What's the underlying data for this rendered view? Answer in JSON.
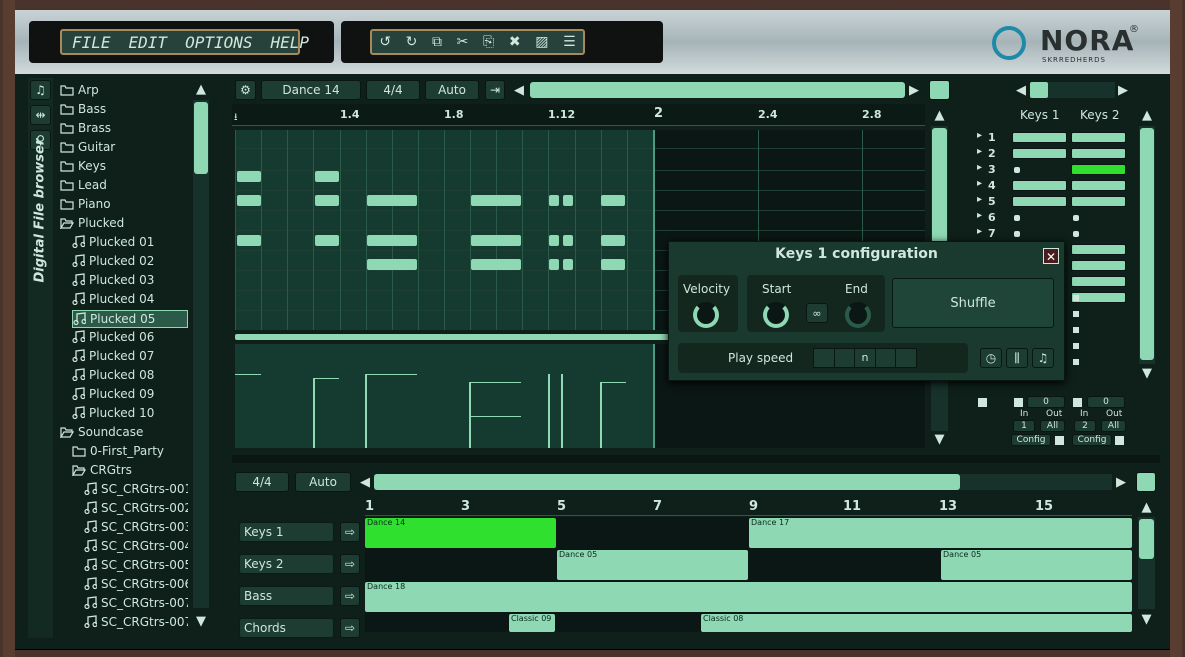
{
  "menu": {
    "file": "FILE",
    "edit": "EDIT",
    "options": "OPTIONS",
    "help": "HELP"
  },
  "logo": {
    "name": "NORA",
    "registered": "®",
    "vendor": "SKRREDHERDS"
  },
  "sidebar": {
    "title": "Digital File browser"
  },
  "browser": {
    "items": [
      {
        "label": "Arp",
        "type": "folder"
      },
      {
        "label": "Bass",
        "type": "folder"
      },
      {
        "label": "Brass",
        "type": "folder"
      },
      {
        "label": "Guitar",
        "type": "folder"
      },
      {
        "label": "Keys",
        "type": "folder"
      },
      {
        "label": "Lead",
        "type": "folder"
      },
      {
        "label": "Piano",
        "type": "folder"
      },
      {
        "label": "Plucked",
        "type": "folder-open"
      },
      {
        "label": "Plucked 01",
        "type": "file"
      },
      {
        "label": "Plucked 02",
        "type": "file"
      },
      {
        "label": "Plucked 03",
        "type": "file"
      },
      {
        "label": "Plucked 04",
        "type": "file"
      },
      {
        "label": "Plucked 05",
        "type": "file",
        "selected": true
      },
      {
        "label": "Plucked 06",
        "type": "file"
      },
      {
        "label": "Plucked 07",
        "type": "file"
      },
      {
        "label": "Plucked 08",
        "type": "file"
      },
      {
        "label": "Plucked 09",
        "type": "file"
      },
      {
        "label": "Plucked 10",
        "type": "file"
      },
      {
        "label": "Soundcase",
        "type": "folder-open"
      },
      {
        "label": "0-First_Party",
        "type": "folder"
      },
      {
        "label": "CRGtrs",
        "type": "folder-open"
      },
      {
        "label": "SC_CRGtrs-001",
        "type": "file"
      },
      {
        "label": "SC_CRGtrs-002",
        "type": "file"
      },
      {
        "label": "SC_CRGtrs-003",
        "type": "file"
      },
      {
        "label": "SC_CRGtrs-004",
        "type": "file"
      },
      {
        "label": "SC_CRGtrs-005",
        "type": "file"
      },
      {
        "label": "SC_CRGtrs-006",
        "type": "file"
      },
      {
        "label": "SC_CRGtrs-007",
        "type": "file"
      },
      {
        "label": "SC_CRGtrs-007",
        "type": "file"
      }
    ]
  },
  "pattern": {
    "name": "Dance 14",
    "signature": "4/4",
    "mode": "Auto"
  },
  "ruler": {
    "marks": [
      "1.4",
      "1.8",
      "1.12",
      "2",
      "2.4",
      "2.8"
    ]
  },
  "keys": {
    "rows": [
      "1",
      "2",
      "3",
      "4",
      "5",
      "6",
      "7"
    ],
    "col1": "Keys 1",
    "col2": "Keys 2",
    "k1_in_value": "0",
    "k1_in": "In",
    "k1_out": "Out",
    "k1_in_ch": "1",
    "k1_out_ch": "All",
    "k1_config": "Config",
    "k2_in_value": "0",
    "k2_in": "In",
    "k2_out": "Out",
    "k2_in_ch": "2",
    "k2_out_ch": "All",
    "k2_config": "Config"
  },
  "dialog": {
    "title": "Keys 1 configuration",
    "velocity": "Velocity",
    "start": "Start",
    "end": "End",
    "shuffle": "Shuffle",
    "play_speed": "Play speed",
    "speed_value": "n"
  },
  "song": {
    "signature": "4/4",
    "mode": "Auto",
    "bars": [
      "1",
      "3",
      "5",
      "7",
      "9",
      "11",
      "13",
      "15"
    ],
    "tracks": [
      "Keys 1",
      "Keys 2",
      "Bass",
      "Chords"
    ],
    "clips": {
      "a": "Dance 14",
      "b": "Dance 17",
      "c": "Dance 05",
      "d": "Dance 05",
      "e": "Dance 18",
      "f": "Classic 09",
      "g": "Classic 08"
    }
  },
  "colors": {
    "accent": "#8fd8b4",
    "active": "#2fe02f",
    "panel": "#0d2019"
  }
}
